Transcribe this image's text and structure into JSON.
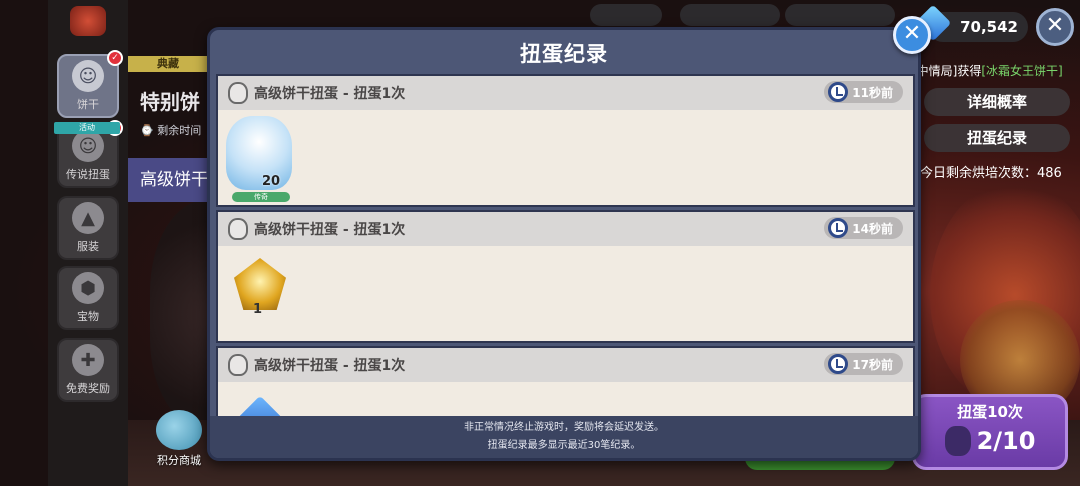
{
  "sidebar": {
    "items": [
      {
        "label": "饼干",
        "icon": "cookie-face-icon"
      },
      {
        "label": "传说扭蛋",
        "icon": "legend-gacha-icon",
        "ribbon": "活动"
      },
      {
        "label": "服装",
        "icon": "shirt-icon"
      },
      {
        "label": "宝物",
        "icon": "treasure-icon"
      },
      {
        "label": "免费奖励",
        "icon": "gift-icon"
      }
    ],
    "shop_label": "积分商城"
  },
  "background": {
    "collection_tag": "典藏",
    "title1": "特别饼",
    "remain_label": "剩余时间",
    "title2": "高级饼干"
  },
  "currency": {
    "crystals": "70,542"
  },
  "right_panel": {
    "ticker_prefix": "[中情局]获得",
    "ticker_item": "[冰霜女王饼干]",
    "detail_prob": "详细概率",
    "gacha_log": "扭蛋纪录",
    "bake_count": "今日剩余烘培次数：486",
    "pull10_label": "扭蛋10次",
    "pull10_count": "2/10"
  },
  "modal": {
    "title": "扭蛋纪录",
    "records": [
      {
        "title": "高级饼干扭蛋 - 扭蛋1次",
        "time": "11秒前",
        "reward": "cookie",
        "qty": "20",
        "rarity": "传奇"
      },
      {
        "title": "高级饼干扭蛋 - 扭蛋1次",
        "time": "14秒前",
        "reward": "treasure",
        "qty": "1"
      },
      {
        "title": "高级饼干扭蛋 - 扭蛋1次",
        "time": "17秒前",
        "reward": "gem"
      }
    ],
    "footer_line1": "非正常情况终止游戏时，奖励将会延迟发送。",
    "footer_line2": "扭蛋纪录最多显示最近30笔纪录。"
  },
  "colors": {
    "modal_bg": "#4d5776",
    "record_bg": "#f1ebe2",
    "header_bg": "#d9d7d6",
    "close_blue": "#3c8de0",
    "pull10_purple": "#7a47b6"
  }
}
